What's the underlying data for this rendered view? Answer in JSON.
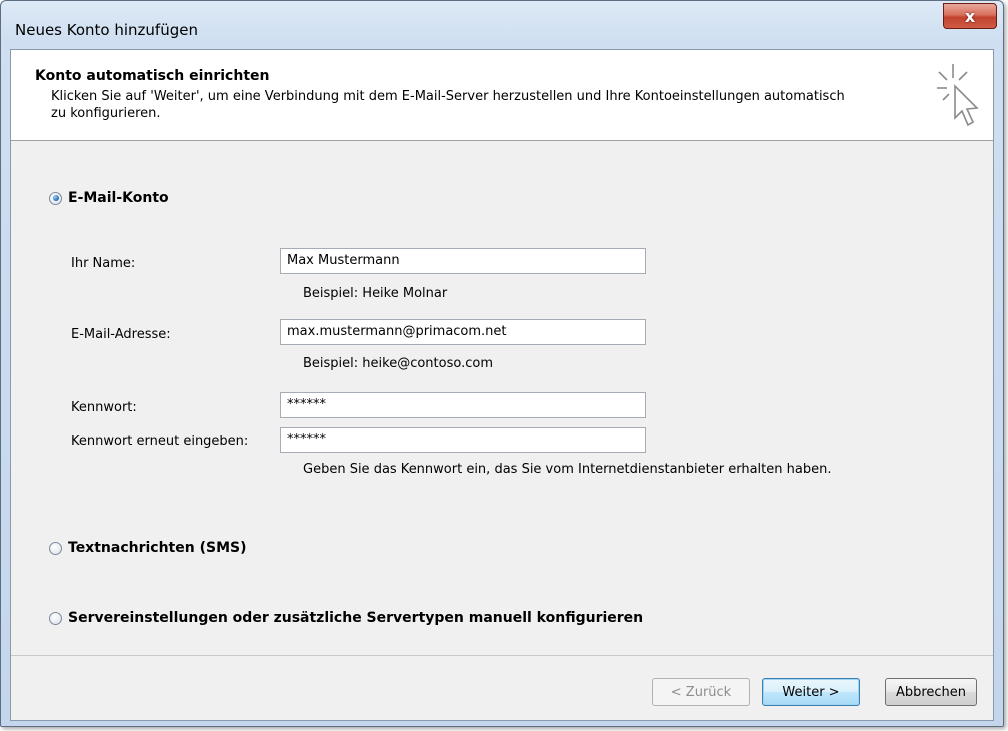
{
  "window": {
    "title": "Neues Konto hinzufügen",
    "close_glyph": "x"
  },
  "header": {
    "title": "Konto automatisch einrichten",
    "description": "Klicken Sie auf 'Weiter', um eine Verbindung mit dem E-Mail-Server herzustellen und Ihre Kontoeinstellungen automatisch zu konfigurieren.",
    "icon": "cursor-sparkle-icon"
  },
  "options": {
    "email": {
      "label": "E-Mail-Konto",
      "checked": true
    },
    "sms": {
      "label": "Textnachrichten (SMS)",
      "checked": false
    },
    "manual": {
      "label": "Servereinstellungen oder zusätzliche Servertypen manuell konfigurieren",
      "checked": false
    }
  },
  "form": {
    "name": {
      "label": "Ihr Name:",
      "value": "Max Mustermann",
      "hint": "Beispiel: Heike Molnar"
    },
    "email": {
      "label": "E-Mail-Adresse:",
      "value": "max.mustermann@primacom.net",
      "hint": "Beispiel: heike@contoso.com"
    },
    "password": {
      "label": "Kennwort:",
      "value": "******"
    },
    "password_repeat": {
      "label": "Kennwort erneut eingeben:",
      "value": "******"
    },
    "password_hint": "Geben Sie das Kennwort ein, das Sie vom Internetdienstanbieter erhalten haben."
  },
  "buttons": {
    "back": "< Zurück",
    "next": "Weiter >",
    "cancel": "Abbrechen"
  }
}
